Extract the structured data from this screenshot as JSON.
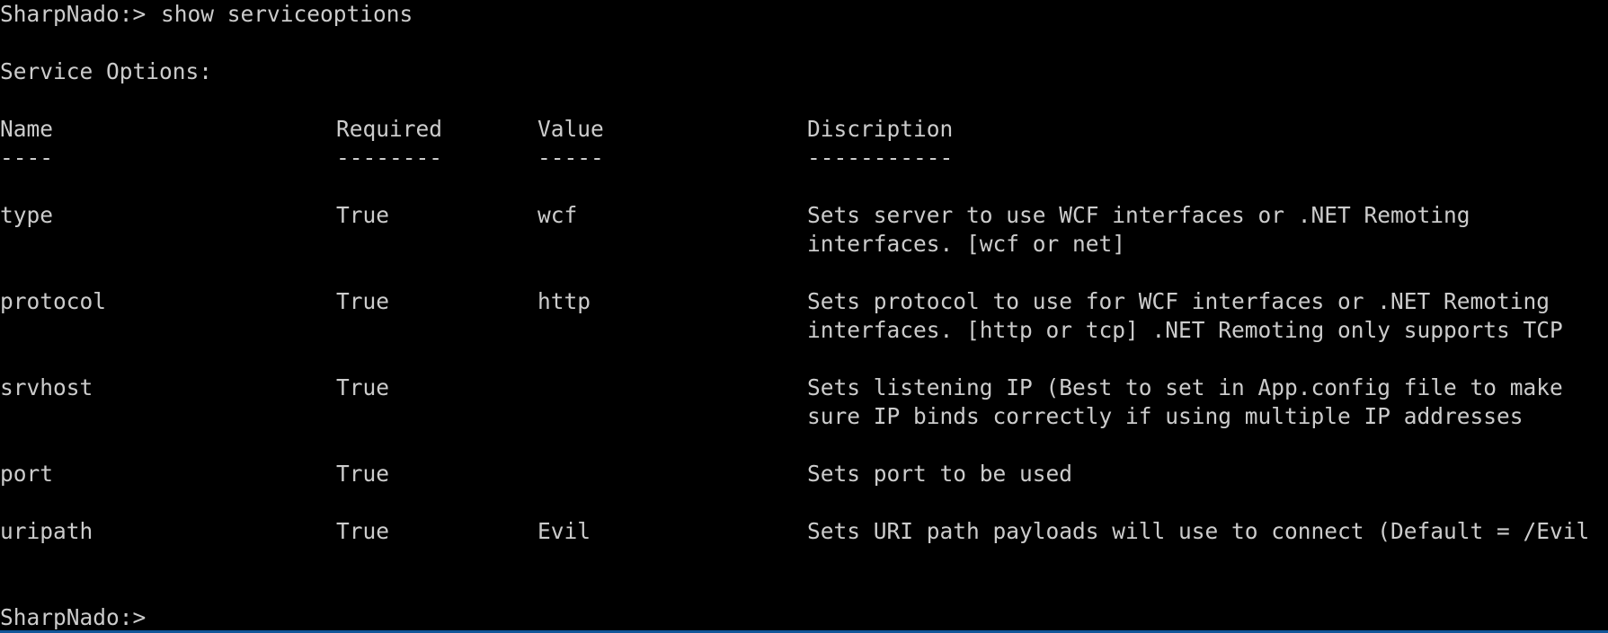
{
  "prompt": "SharpNado:>",
  "command": "show serviceoptions",
  "section_title": "Service Options:",
  "columns": {
    "name": "Name",
    "required": "Required",
    "value": "Value",
    "description": "Discription"
  },
  "underlines": {
    "name": "----",
    "required": "--------",
    "value": "-----",
    "description": "-----------"
  },
  "rows": [
    {
      "name": "type",
      "required": "True",
      "value": "wcf",
      "desc1": "Sets server to use WCF interfaces or .NET Remoting",
      "desc2": "interfaces. [wcf or net]"
    },
    {
      "name": "protocol",
      "required": "True",
      "value": "http",
      "desc1": "Sets protocol to use for WCF interfaces or .NET Remoting",
      "desc2": "interfaces. [http or tcp] .NET Remoting only supports TCP"
    },
    {
      "name": "srvhost",
      "required": "True",
      "value": "",
      "desc1": "Sets listening IP (Best to set in App.config file to make",
      "desc2": "sure IP binds correctly if using multiple IP addresses"
    },
    {
      "name": "port",
      "required": "True",
      "value": "",
      "desc1": "Sets port to be used",
      "desc2": ""
    },
    {
      "name": "uripath",
      "required": "True",
      "value": "Evil",
      "desc1": "Sets URI path payloads will use to connect (Default = /Evil",
      "desc2": ""
    }
  ],
  "final_prompt": "SharpNado:>"
}
